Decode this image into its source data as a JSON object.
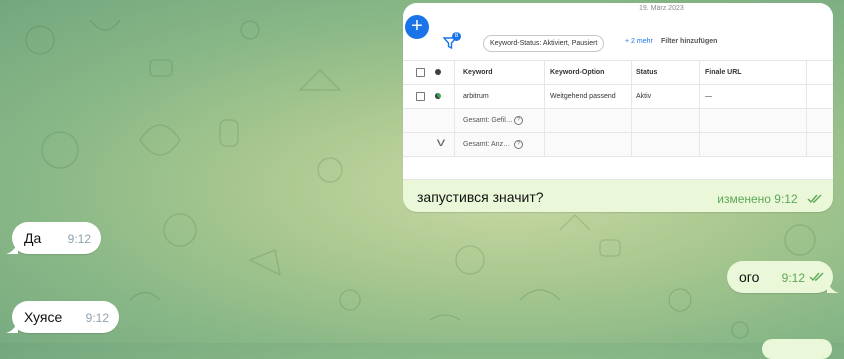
{
  "screenshot": {
    "date": "19. März 2023",
    "filter_badge": "8",
    "filter_chip": "Keyword-Status: Aktiviert, Pausiert",
    "more_filters": "+ 2 mehr",
    "add_filter": "Filter hinzufügen",
    "columns": [
      "Keyword",
      "Keyword-Option",
      "Status",
      "Finale URL"
    ],
    "rows": [
      {
        "keyword": "arbitrum",
        "option": "Weitgehend passend",
        "status": "Aktiv",
        "url": "—"
      }
    ],
    "totals": [
      "Gesamt: Gefil…",
      "Gesamt: Anz…"
    ]
  },
  "messages": {
    "screenshot_caption": "запустився значит?",
    "screenshot_meta": "изменено 9:12",
    "m1_text": "Да",
    "m1_time": "9:12",
    "m2_text": "ого",
    "m2_time": "9:12",
    "m3_text": "Хуясе",
    "m3_time": "9:12"
  },
  "colors": {
    "outgoing_bubble": "#eaf7d8",
    "incoming_bubble": "#ffffff",
    "outgoing_meta": "#5ea857",
    "accent_blue": "#1a73e8"
  }
}
